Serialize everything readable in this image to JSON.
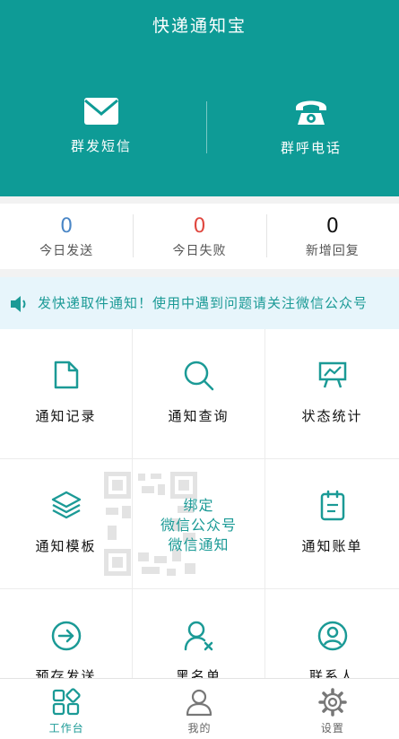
{
  "app": {
    "title": "快递通知宝"
  },
  "hero": {
    "left_label": "群发短信",
    "right_label": "群呼电话"
  },
  "stats": [
    {
      "value": "0",
      "label": "今日发送",
      "color": "#4a86c6"
    },
    {
      "value": "0",
      "label": "今日失败",
      "color": "#e0473f"
    },
    {
      "value": "0",
      "label": "新增回复",
      "color": "#111111"
    }
  ],
  "notice": {
    "text": "发快递取件通知！使用中遇到问题请关注微信公众号"
  },
  "grid": {
    "items": [
      {
        "label": "通知记录",
        "icon": "document-icon"
      },
      {
        "label": "通知查询",
        "icon": "search-icon"
      },
      {
        "label": "状态统计",
        "icon": "chart-board-icon"
      },
      {
        "label": "通知模板",
        "icon": "layers-icon"
      },
      {
        "label": "通知账单",
        "icon": "clipboard-icon"
      },
      {
        "label": "预存发送",
        "icon": "arrow-circle-icon"
      },
      {
        "label": "黑名单",
        "icon": "user-block-icon"
      },
      {
        "label": "联系人",
        "icon": "contact-icon"
      }
    ],
    "qr": {
      "line1": "绑定",
      "line2": "微信公众号",
      "line3": "微信通知"
    }
  },
  "nav": {
    "items": [
      {
        "label": "工作台",
        "icon": "workbench-icon"
      },
      {
        "label": "我的",
        "icon": "user-icon"
      },
      {
        "label": "设置",
        "icon": "gear-icon"
      }
    ]
  },
  "colors": {
    "brand": "#0e9b96",
    "accent_text": "#1b9a96"
  }
}
